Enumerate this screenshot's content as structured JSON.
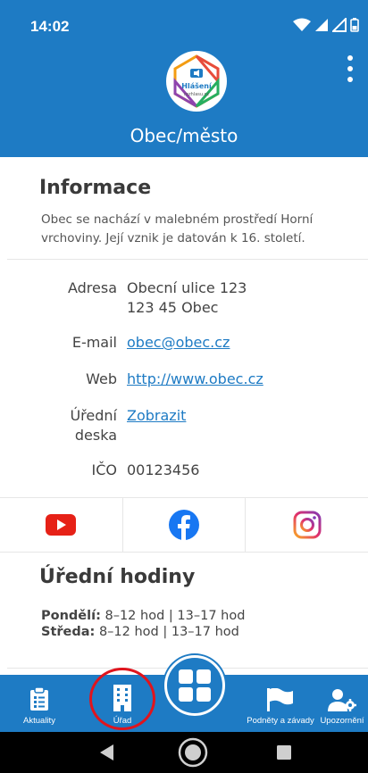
{
  "status_bar": {
    "time": "14:02"
  },
  "header": {
    "title": "Obec/město",
    "logo_text_1": "Hlášení",
    "logo_text_2": "rozhlasu.cz"
  },
  "info": {
    "title": "Informace",
    "description": "Obec se nachází v malebném prostředí Horní vrchoviny. Její vznik je datován k 16. století.",
    "rows": [
      {
        "label": "Adresa",
        "value_1": "Obecní ulice 123",
        "value_2": "123 45 Obec"
      },
      {
        "label": "E-mail",
        "value": "obec@obec.cz"
      },
      {
        "label": "Web",
        "value": "http://www.obec.cz"
      },
      {
        "label_1": "Úřední",
        "label_2": "deska",
        "value": "Zobrazit"
      },
      {
        "label": "IČO",
        "value": "00123456"
      }
    ]
  },
  "social": {
    "items": [
      "youtube",
      "facebook",
      "instagram"
    ]
  },
  "hours": {
    "title": "Úřední hodiny",
    "lines": [
      {
        "day": "Pondělí:",
        "time": "8–12 hod | 13–17 hod"
      },
      {
        "day": "Středa:",
        "time": "8–12 hod | 13–17 hod"
      }
    ]
  },
  "bottom_nav": {
    "items": [
      {
        "label": "Aktuality",
        "icon": "clipboard-icon"
      },
      {
        "label": "Úřad",
        "icon": "building-icon"
      },
      {
        "label": "Podněty a závady",
        "icon": "flag-icon"
      },
      {
        "label": "Upozornění",
        "icon": "user-settings-icon"
      }
    ],
    "fab_icon": "grid-icon"
  },
  "colors": {
    "primary": "#1e7bc4",
    "youtube": "#e62117",
    "facebook": "#1877f2",
    "highlight": "#e0141d"
  }
}
